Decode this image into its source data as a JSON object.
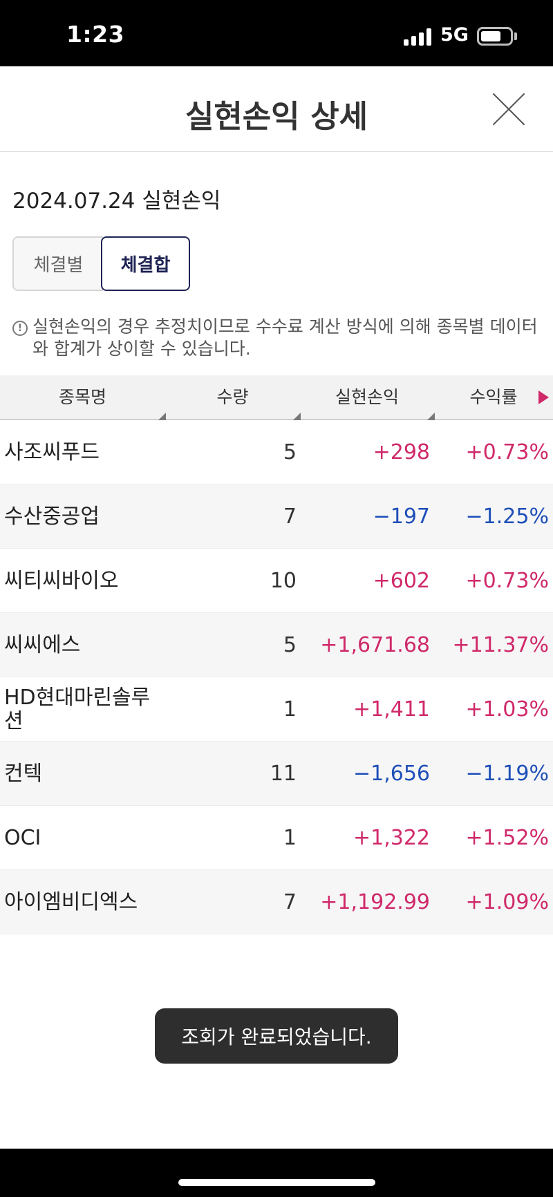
{
  "status_bar": {
    "time": "1:23",
    "network": "5G",
    "battery_icon": "battery-icon",
    "signal_icon": "signal-icon"
  },
  "header": {
    "title": "실현손익 상세",
    "close_icon": "close-icon"
  },
  "date_title": "2024.07.24 실현손익",
  "segments": [
    {
      "label": "체결별",
      "selected": false
    },
    {
      "label": "체결합",
      "selected": true
    }
  ],
  "notice": {
    "icon": "info-icon",
    "icon_glyph": "!",
    "text": "실현손익의 경우 추정치이므로 수수료 계산 방식에 의해 종목별 데이터와 합계가 상이할 수 있습니다."
  },
  "table": {
    "headers": [
      "종목명",
      "수량",
      "실현손익",
      "수익률"
    ],
    "rows": [
      {
        "name": "사조씨푸드",
        "qty": "5",
        "pnl": "+298",
        "rate": "+0.73%"
      },
      {
        "name": "수산중공업",
        "qty": "7",
        "pnl": "−197",
        "rate": "−1.25%"
      },
      {
        "name": "씨티씨바이오",
        "qty": "10",
        "pnl": "+602",
        "rate": "+0.73%"
      },
      {
        "name": "씨씨에스",
        "qty": "5",
        "pnl": "+1,671.68",
        "rate": "+11.37%"
      },
      {
        "name": "HD현대마린솔루션",
        "qty": "1",
        "pnl": "+1,411",
        "rate": "+1.03%"
      },
      {
        "name": "컨텍",
        "qty": "11",
        "pnl": "−1,656",
        "rate": "−1.19%"
      },
      {
        "name": "OCI",
        "qty": "1",
        "pnl": "+1,322",
        "rate": "+1.52%"
      },
      {
        "name": "아이엠비디엑스",
        "qty": "7",
        "pnl": "+1,192.99",
        "rate": "+1.09%"
      }
    ]
  },
  "toast": "조회가 완료되었습니다.",
  "colors": {
    "positive": "#d0296a",
    "negative": "#1e4fb8",
    "accent": "#1f2454"
  }
}
